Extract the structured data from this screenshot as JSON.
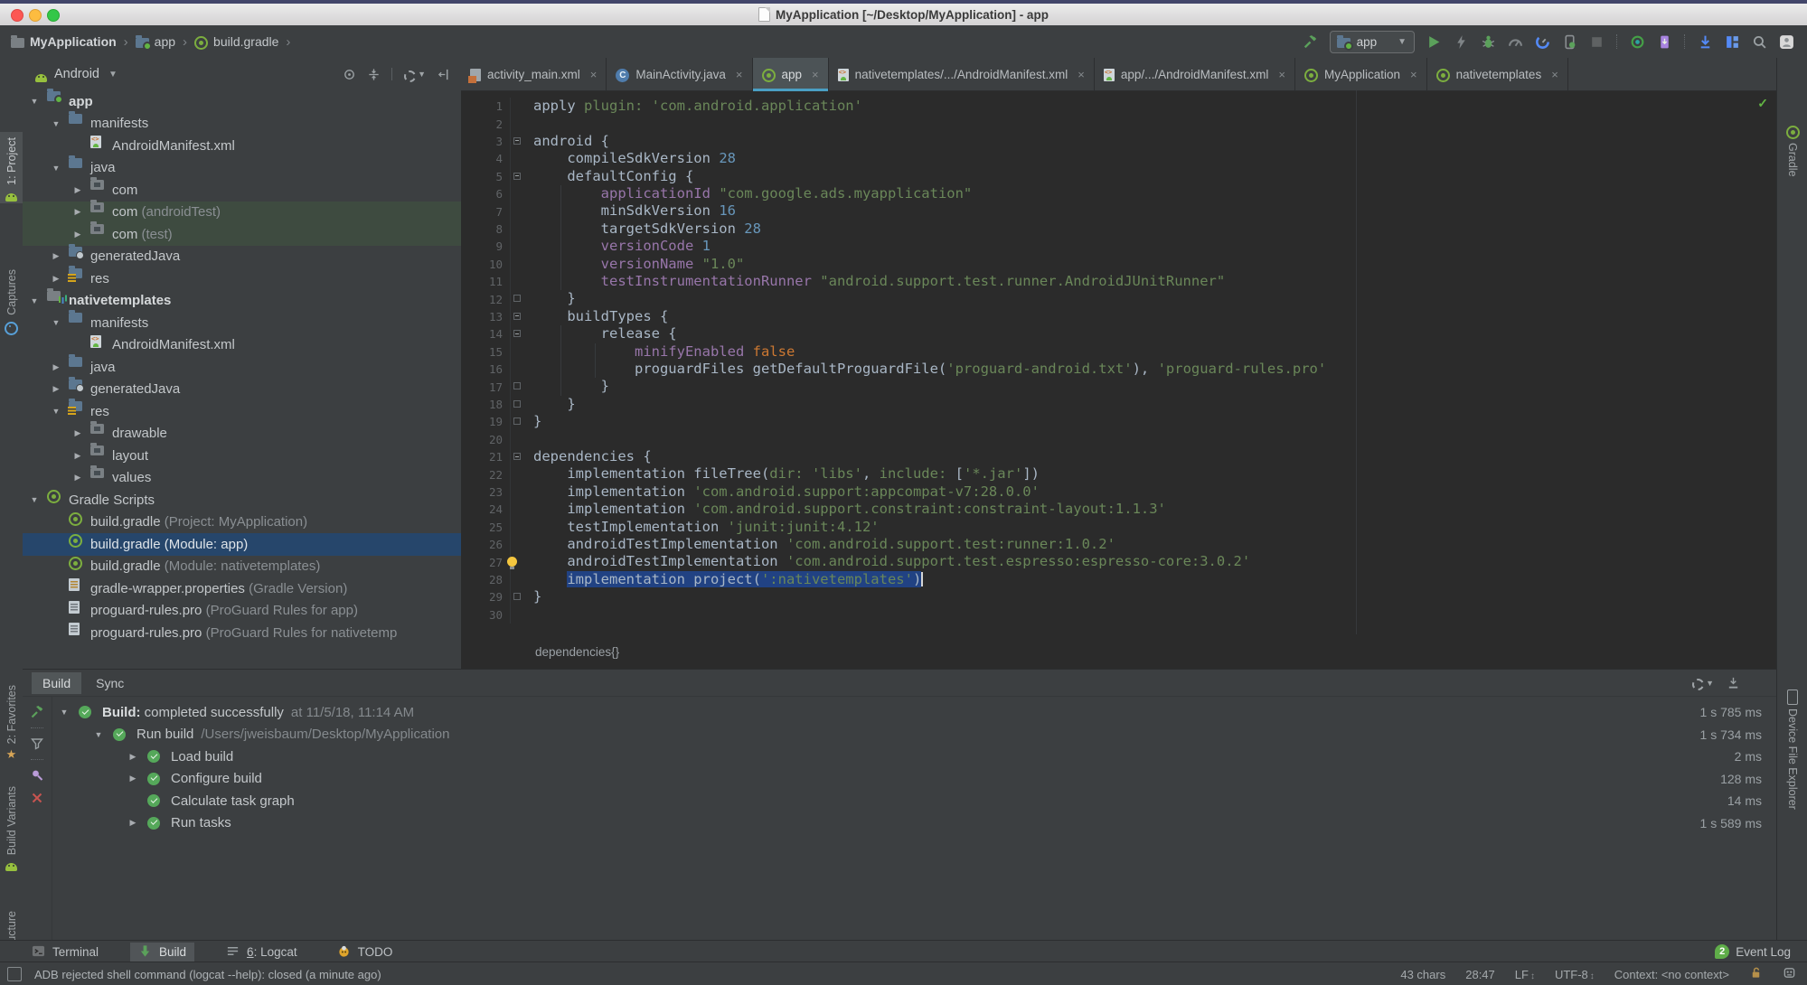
{
  "window": {
    "title": "MyApplication [~/Desktop/MyApplication] - app"
  },
  "colors": {
    "accent_tab_underline": "#4A9FC4",
    "editor_selection": "#214283",
    "tree_selection": "#26466B",
    "success_green": "#62B543",
    "editor_bg": "#2b2b2b"
  },
  "breadcrumb_bar": {
    "items": [
      {
        "label": "MyApplication",
        "icon": "folder-project"
      },
      {
        "label": "app",
        "icon": "folder-app"
      },
      {
        "label": "build.gradle",
        "icon": "gradle"
      }
    ]
  },
  "toolbar": {
    "run_config": {
      "label": "app"
    },
    "icons": [
      {
        "name": "run-button",
        "glyph": "play"
      },
      {
        "name": "apply-changes-button",
        "glyph": "bolt"
      },
      {
        "name": "debug-button",
        "glyph": "bug"
      },
      {
        "name": "profile-button",
        "glyph": "meter"
      },
      {
        "name": "profiler-button",
        "glyph": "gauge"
      },
      {
        "name": "run-on-device-button",
        "glyph": "phone"
      },
      {
        "name": "stop-button",
        "glyph": "stop"
      },
      {
        "sep": true
      },
      {
        "name": "avd-manager-button",
        "glyph": "device"
      },
      {
        "name": "sdk-manager-button",
        "glyph": "sdk"
      },
      {
        "sep": true
      },
      {
        "name": "sync-project-button",
        "glyph": "down"
      },
      {
        "name": "layout-inspector-button",
        "glyph": "layout"
      },
      {
        "name": "search-everywhere-button",
        "glyph": "search"
      },
      {
        "name": "profile-account-button",
        "glyph": "user"
      }
    ]
  },
  "project_panel": {
    "selector_label": "Android",
    "tree": [
      {
        "label": "app",
        "depth": 0,
        "arrow": "down",
        "icon": "folder-app",
        "bold": true
      },
      {
        "label": "manifests",
        "depth": 1,
        "arrow": "down",
        "icon": "folder"
      },
      {
        "label": "AndroidManifest.xml",
        "depth": 2,
        "arrow": "",
        "icon": "manifest"
      },
      {
        "label": "java",
        "depth": 1,
        "arrow": "down",
        "icon": "folder"
      },
      {
        "label": "com",
        "depth": 2,
        "arrow": "right",
        "icon": "package"
      },
      {
        "label": "com",
        "note": "(androidTest)",
        "depth": 2,
        "arrow": "right",
        "icon": "package",
        "row": "hl"
      },
      {
        "label": "com",
        "note": "(test)",
        "depth": 2,
        "arrow": "right",
        "icon": "package",
        "row": "hl"
      },
      {
        "label": "generatedJava",
        "depth": 1,
        "arrow": "right",
        "icon": "folder-gen"
      },
      {
        "label": "res",
        "depth": 1,
        "arrow": "right",
        "icon": "folder-res"
      },
      {
        "label": "nativetemplates",
        "depth": 0,
        "arrow": "down",
        "icon": "module",
        "bold": true
      },
      {
        "label": "manifests",
        "depth": 1,
        "arrow": "down",
        "icon": "folder"
      },
      {
        "label": "AndroidManifest.xml",
        "depth": 2,
        "arrow": "",
        "icon": "manifest"
      },
      {
        "label": "java",
        "depth": 1,
        "arrow": "right",
        "icon": "folder"
      },
      {
        "label": "generatedJava",
        "depth": 1,
        "arrow": "right",
        "icon": "folder-gen"
      },
      {
        "label": "res",
        "depth": 1,
        "arrow": "down",
        "icon": "folder-res"
      },
      {
        "label": "drawable",
        "depth": 2,
        "arrow": "right",
        "icon": "package"
      },
      {
        "label": "layout",
        "depth": 2,
        "arrow": "right",
        "icon": "package"
      },
      {
        "label": "values",
        "depth": 2,
        "arrow": "right",
        "icon": "package"
      },
      {
        "label": "Gradle Scripts",
        "depth": 0,
        "arrow": "down",
        "icon": "gradle"
      },
      {
        "label": "build.gradle",
        "note": "(Project: MyApplication)",
        "depth": 1,
        "arrow": "",
        "icon": "gradle"
      },
      {
        "label": "build.gradle",
        "note": "(Module: app)",
        "depth": 1,
        "arrow": "",
        "icon": "gradle",
        "row": "sel"
      },
      {
        "label": "build.gradle",
        "note": "(Module: nativetemplates)",
        "depth": 1,
        "arrow": "",
        "icon": "gradle"
      },
      {
        "label": "gradle-wrapper.properties",
        "note": "(Gradle Version)",
        "depth": 1,
        "arrow": "",
        "icon": "props"
      },
      {
        "label": "proguard-rules.pro",
        "note": "(ProGuard Rules for app)",
        "depth": 1,
        "arrow": "",
        "icon": "file"
      },
      {
        "label": "proguard-rules.pro",
        "note": "(ProGuard Rules for nativetemp",
        "depth": 1,
        "arrow": "",
        "icon": "file"
      }
    ]
  },
  "editor": {
    "tabs": [
      {
        "label": "activity_main.xml",
        "icon": "layout",
        "active": false
      },
      {
        "label": "MainActivity.java",
        "icon": "java",
        "active": false
      },
      {
        "label": "app",
        "icon": "gradle",
        "active": true
      },
      {
        "label": "nativetemplates/.../AndroidManifest.xml",
        "icon": "manifest",
        "active": false
      },
      {
        "label": "app/.../AndroidManifest.xml",
        "icon": "manifest",
        "active": false
      },
      {
        "label": "MyApplication",
        "icon": "gradle",
        "active": false
      },
      {
        "label": "nativetemplates",
        "icon": "gradle",
        "active": false
      }
    ],
    "breadcrumb": "dependencies{}",
    "lines": [
      {
        "n": 1,
        "t": [
          [
            "apply ",
            "d"
          ],
          [
            "plugin: ",
            "s"
          ],
          [
            "'com.android.application'",
            "s"
          ]
        ]
      },
      {
        "n": 2,
        "t": []
      },
      {
        "n": 3,
        "t": [
          [
            "android {",
            "d"
          ]
        ],
        "fold": "start"
      },
      {
        "n": 4,
        "t": [
          [
            "    compileSdkVersion ",
            "d"
          ],
          [
            "28",
            "n"
          ]
        ]
      },
      {
        "n": 5,
        "t": [
          [
            "    defaultConfig {",
            "d"
          ]
        ],
        "fold": "start"
      },
      {
        "n": 6,
        "t": [
          [
            "        applicationId ",
            "p"
          ],
          [
            "\"com.google.ads.myapplication\"",
            "s"
          ]
        ]
      },
      {
        "n": 7,
        "t": [
          [
            "        minSdkVersion ",
            "d"
          ],
          [
            "16",
            "n"
          ]
        ]
      },
      {
        "n": 8,
        "t": [
          [
            "        targetSdkVersion ",
            "d"
          ],
          [
            "28",
            "n"
          ]
        ]
      },
      {
        "n": 9,
        "t": [
          [
            "        versionCode ",
            "p"
          ],
          [
            "1",
            "n"
          ]
        ]
      },
      {
        "n": 10,
        "t": [
          [
            "        versionName ",
            "p"
          ],
          [
            "\"1.0\"",
            "s"
          ]
        ]
      },
      {
        "n": 11,
        "t": [
          [
            "        testInstrumentationRunner ",
            "p"
          ],
          [
            "\"android.support.test.runner.AndroidJUnitRunner\"",
            "s"
          ]
        ]
      },
      {
        "n": 12,
        "t": [
          [
            "    }",
            "d"
          ]
        ],
        "fold": "end"
      },
      {
        "n": 13,
        "t": [
          [
            "    buildTypes {",
            "d"
          ]
        ],
        "fold": "start"
      },
      {
        "n": 14,
        "t": [
          [
            "        release {",
            "d"
          ]
        ],
        "fold": "start"
      },
      {
        "n": 15,
        "t": [
          [
            "            minifyEnabled ",
            "p"
          ],
          [
            "false",
            "k"
          ]
        ]
      },
      {
        "n": 16,
        "t": [
          [
            "            proguardFiles getDefaultProguardFile(",
            "d"
          ],
          [
            "'proguard-android.txt'",
            "s"
          ],
          [
            "), ",
            "d"
          ],
          [
            "'proguard-rules.pro'",
            "s"
          ]
        ]
      },
      {
        "n": 17,
        "t": [
          [
            "        }",
            "d"
          ]
        ],
        "fold": "end"
      },
      {
        "n": 18,
        "t": [
          [
            "    }",
            "d"
          ]
        ],
        "fold": "end"
      },
      {
        "n": 19,
        "t": [
          [
            "}",
            "d"
          ]
        ],
        "fold": "end"
      },
      {
        "n": 20,
        "t": []
      },
      {
        "n": 21,
        "t": [
          [
            "dependencies {",
            "d"
          ]
        ],
        "fold": "start"
      },
      {
        "n": 22,
        "t": [
          [
            "    implementation fileTree(",
            "d"
          ],
          [
            "dir: ",
            "s"
          ],
          [
            "'libs'",
            "s"
          ],
          [
            ", ",
            "d"
          ],
          [
            "include: ",
            "s"
          ],
          [
            "[",
            "d"
          ],
          [
            "'*.jar'",
            "s"
          ],
          [
            "])",
            "d"
          ]
        ]
      },
      {
        "n": 23,
        "t": [
          [
            "    implementation ",
            "d"
          ],
          [
            "'com.android.support:appcompat-v7:28.0.0'",
            "s"
          ]
        ]
      },
      {
        "n": 24,
        "t": [
          [
            "    implementation ",
            "d"
          ],
          [
            "'com.android.support.constraint:constraint-layout:1.1.3'",
            "s"
          ]
        ]
      },
      {
        "n": 25,
        "t": [
          [
            "    testImplementation ",
            "d"
          ],
          [
            "'junit:junit:4.12'",
            "s"
          ]
        ]
      },
      {
        "n": 26,
        "t": [
          [
            "    androidTestImplementation ",
            "d"
          ],
          [
            "'com.android.support.test:runner:1.0.2'",
            "s"
          ]
        ]
      },
      {
        "n": 27,
        "t": [
          [
            "    androidTestImplementation ",
            "d"
          ],
          [
            "'com.android.support.test.espresso:espresso-core:3.0.2'",
            "s"
          ]
        ],
        "bulb": true
      },
      {
        "n": 28,
        "t": [
          [
            "    ",
            "d"
          ],
          [
            "implementation project(",
            "d",
            1
          ],
          [
            "':nativetemplates'",
            "s",
            1
          ],
          [
            ")",
            "d",
            1
          ]
        ],
        "caret": true
      },
      {
        "n": 29,
        "t": [
          [
            "}",
            "d"
          ]
        ],
        "fold": "end"
      },
      {
        "n": 30,
        "t": []
      }
    ]
  },
  "build_panel": {
    "tabs": [
      {
        "label": "Build",
        "active": true
      },
      {
        "label": "Sync",
        "active": false
      }
    ],
    "rows": [
      {
        "depth": 0,
        "arrow": "down",
        "prefix": "Build:",
        "label": " completed successfully",
        "note": "at 11/5/18, 11:14 AM",
        "time": "1 s 785 ms"
      },
      {
        "depth": 1,
        "arrow": "down",
        "prefix": "",
        "label": "Run build",
        "note": "/Users/jweisbaum/Desktop/MyApplication",
        "time": "1 s 734 ms"
      },
      {
        "depth": 2,
        "arrow": "right",
        "prefix": "",
        "label": "Load build",
        "note": "",
        "time": "2 ms"
      },
      {
        "depth": 2,
        "arrow": "right",
        "prefix": "",
        "label": "Configure build",
        "note": "",
        "time": "128 ms"
      },
      {
        "depth": 2,
        "arrow": "",
        "prefix": "",
        "label": "Calculate task graph",
        "note": "",
        "time": "14 ms"
      },
      {
        "depth": 2,
        "arrow": "right",
        "prefix": "",
        "label": "Run tasks",
        "note": "",
        "time": "1 s 589 ms"
      }
    ]
  },
  "bottom_bar": {
    "items": [
      {
        "label": "Terminal",
        "icon": "terminal",
        "active": false
      },
      {
        "label": "Build",
        "icon": "build-arrow",
        "active": true
      },
      {
        "label": "6: Logcat",
        "icon": "logcat",
        "active": false
      },
      {
        "label": "TODO",
        "icon": "todo",
        "active": false
      }
    ],
    "event_log": {
      "label": "Event Log",
      "badge": "2"
    }
  },
  "status_bar": {
    "message": "ADB rejected shell command (logcat --help): closed (a minute ago)",
    "chars": "43 chars",
    "position": "28:47",
    "line_ending": "LF",
    "encoding": "UTF-8",
    "context": "Context: <no context>"
  },
  "left_strip": [
    {
      "label": "1: Project",
      "icon": "project",
      "active": true
    },
    {
      "label": "Captures",
      "icon": "captures",
      "active": false
    },
    {
      "label": "2: Favorites",
      "icon": "favorites",
      "active": false
    },
    {
      "label": "Build Variants",
      "icon": "build-variants",
      "active": false
    },
    {
      "label": "Z: Structure",
      "icon": "structure",
      "active": false
    }
  ],
  "right_strip": [
    {
      "label": "Gradle",
      "icon": "gradle",
      "active": false
    },
    {
      "label": "Device File Explorer",
      "icon": "device-file-explorer",
      "active": false
    }
  ]
}
